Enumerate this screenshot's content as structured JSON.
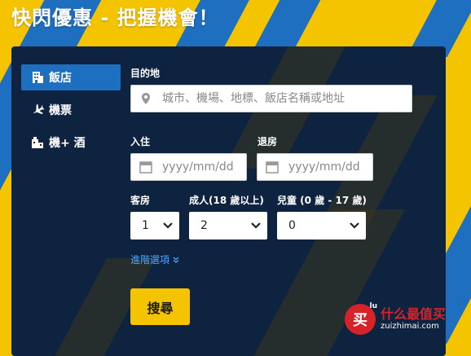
{
  "headline": "快閃優惠 - 把握機會！",
  "tabs": [
    {
      "label": "飯店",
      "icon": "hotel-icon"
    },
    {
      "label": "機票",
      "icon": "airplane-icon"
    },
    {
      "label": "機+ 酒",
      "icon": "package-icon"
    }
  ],
  "destination": {
    "label": "目的地",
    "placeholder": "城市、機場、地標、飯店名稱或地址",
    "icon": "location-pin-icon"
  },
  "checkin": {
    "label": "入住",
    "placeholder": "yyyy/mm/dd",
    "icon": "calendar-icon"
  },
  "checkout": {
    "label": "退房",
    "placeholder": "yyyy/mm/dd",
    "icon": "calendar-icon"
  },
  "rooms": {
    "label": "客房",
    "value": "1"
  },
  "adults": {
    "label": "成人(18 歲以上)",
    "value": "2"
  },
  "children": {
    "label": "兒童 (0 歲 - 17 歲)",
    "value": "0"
  },
  "advanced": {
    "label": "進階選項",
    "icon": "double-chevron-down-icon"
  },
  "search_button": "搜尋",
  "watermark": {
    "badge": "买",
    "badge_sup": "lu",
    "cn": "什么最值买",
    "en": "zuizhimai.com"
  },
  "colors": {
    "accent_blue": "#1e6fc0",
    "brand_yellow": "#f5c400",
    "panel_navy": "#0d2340",
    "link_blue": "#4aa3ff"
  }
}
